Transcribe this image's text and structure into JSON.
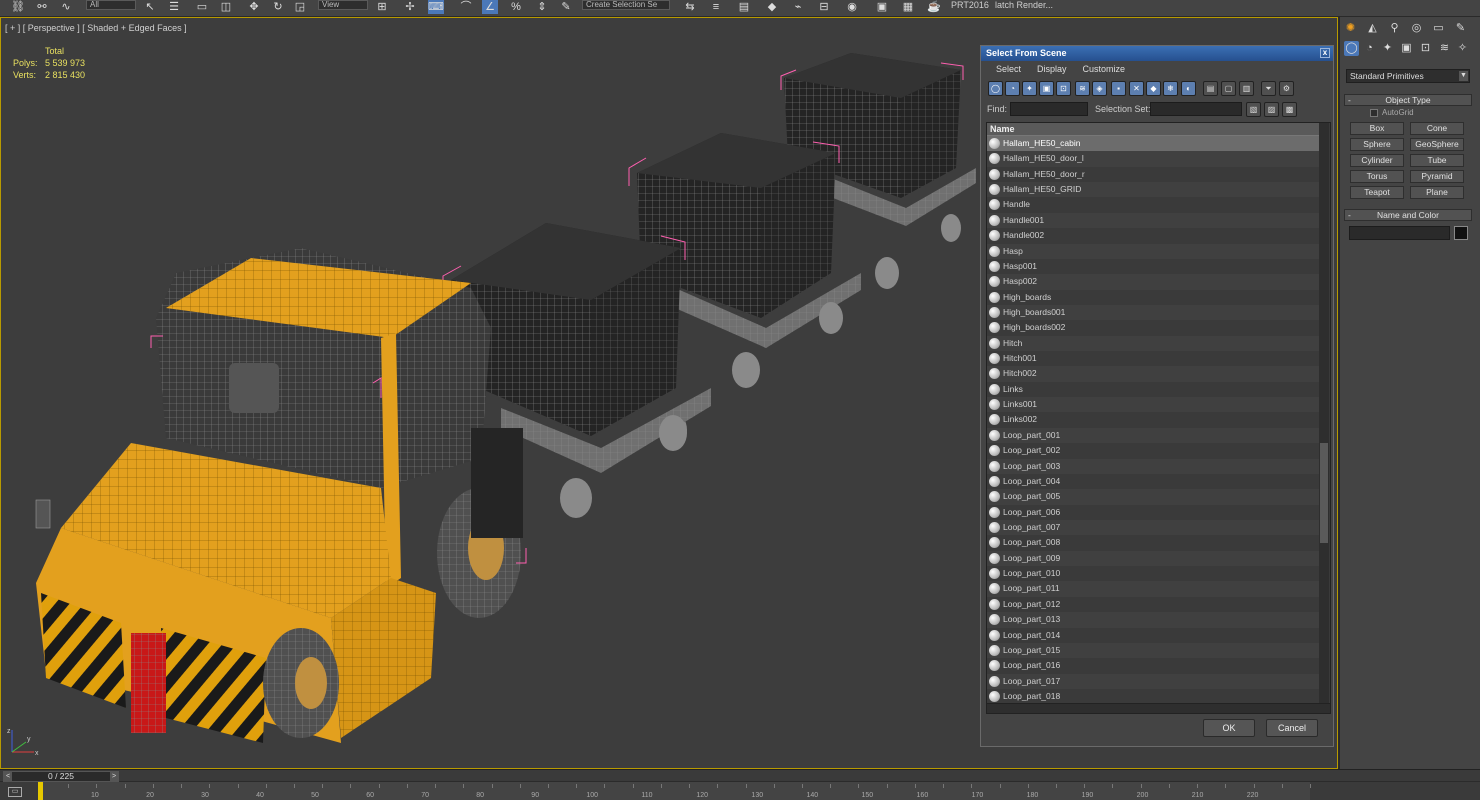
{
  "toolbar": {
    "filter_value": "All",
    "refcoord_value": "View",
    "selection_set_placeholder": "Create Selection Se",
    "prt_label": "PRT2016",
    "batch_render_label": "latch Render..."
  },
  "viewport": {
    "label": "[ + ] [ Perspective ] [ Shaded + Edged Faces ]",
    "stats": {
      "header": "Total",
      "polys_label": "Polys:",
      "polys_value": "5 539 973",
      "verts_label": "Verts:",
      "verts_value": "2 815 430"
    },
    "axis": {
      "x": "x",
      "y": "y",
      "z": "z"
    }
  },
  "dialog": {
    "title": "Select From Scene",
    "close_glyph": "x",
    "menu": [
      "Select",
      "Display",
      "Customize"
    ],
    "find_label": "Find:",
    "find_value": "",
    "selection_set_label": "Selection Set:",
    "selection_set_value": "",
    "column_header": "Name",
    "items": [
      "Hallam_HE50_cabin",
      "Hallam_HE50_door_l",
      "Hallam_HE50_door_r",
      "Hallam_HE50_GRID",
      "Handle",
      "Handle001",
      "Handle002",
      "Hasp",
      "Hasp001",
      "Hasp002",
      "High_boards",
      "High_boards001",
      "High_boards002",
      "Hitch",
      "Hitch001",
      "Hitch002",
      "Links",
      "Links001",
      "Links002",
      "Loop_part_001",
      "Loop_part_002",
      "Loop_part_003",
      "Loop_part_004",
      "Loop_part_005",
      "Loop_part_006",
      "Loop_part_007",
      "Loop_part_008",
      "Loop_part_009",
      "Loop_part_010",
      "Loop_part_011",
      "Loop_part_012",
      "Loop_part_013",
      "Loop_part_014",
      "Loop_part_015",
      "Loop_part_016",
      "Loop_part_017",
      "Loop_part_018"
    ],
    "ok_label": "OK",
    "cancel_label": "Cancel"
  },
  "command_panel": {
    "category_value": "Standard Primitives",
    "object_type_title": "Object Type",
    "autogrid_label": "AutoGrid",
    "primitives": [
      "Box",
      "Cone",
      "Sphere",
      "GeoSphere",
      "Cylinder",
      "Tube",
      "Torus",
      "Pyramid",
      "Teapot",
      "Plane"
    ],
    "name_color_title": "Name and Color",
    "name_value": "",
    "rollout_glyph": "-"
  },
  "timeline": {
    "slider_text": "0 / 225",
    "prev_glyph": "<",
    "next_glyph": ">",
    "ticks": [
      "10",
      "20",
      "30",
      "40",
      "50",
      "60",
      "70",
      "80",
      "90",
      "100",
      "110",
      "120",
      "130",
      "140",
      "150",
      "160",
      "170",
      "180",
      "190",
      "200",
      "210",
      "220"
    ]
  },
  "colors": {
    "viewport_border": "#b89a00",
    "stats_text": "#e8e060",
    "dialog_title": "#2b5c9e",
    "selected_row": "#6c6c6c",
    "time_cursor": "#e6c800"
  }
}
